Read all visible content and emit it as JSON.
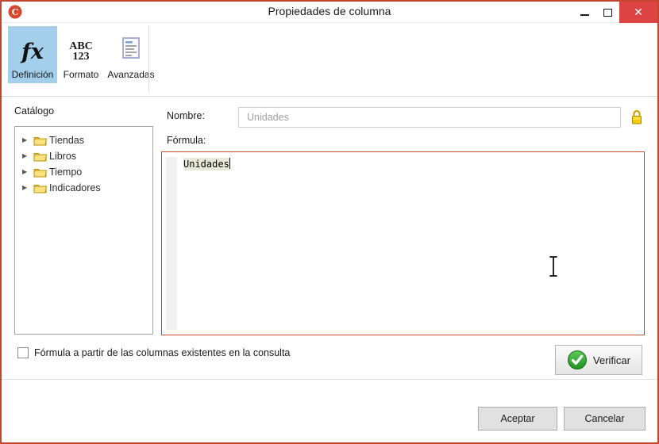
{
  "window": {
    "title": "Propiedades de columna"
  },
  "icons": {
    "app_logo_glyph": "C",
    "close_glyph": "✕",
    "tree_collapsed_glyph": "▶",
    "fx_glyph": "fx",
    "abc_line1": "ABC",
    "abc_line2": "123"
  },
  "toolbar": {
    "tabs": [
      {
        "label": "Definición",
        "icon": "fx-icon",
        "selected": true
      },
      {
        "label": "Formato",
        "icon": "abc-123-icon",
        "selected": false
      },
      {
        "label": "Avanzadas",
        "icon": "list-form-icon",
        "selected": false
      }
    ]
  },
  "catalog": {
    "label": "Catálogo",
    "items": [
      {
        "label": "Tiendas",
        "icon": "folder-icon",
        "expanded": false
      },
      {
        "label": "Libros",
        "icon": "folder-icon",
        "expanded": false
      },
      {
        "label": "Tiempo",
        "icon": "folder-icon",
        "expanded": false
      },
      {
        "label": "Indicadores",
        "icon": "folder-icon",
        "expanded": false
      }
    ]
  },
  "fields": {
    "name": {
      "label": "Nombre:",
      "value": "Unidades",
      "locked": true
    },
    "formula": {
      "label": "Fórmula:",
      "value": "Unidades"
    }
  },
  "options": {
    "from_existing_columns": {
      "label": "Fórmula a partir de las columnas existentes en la consulta",
      "checked": false
    }
  },
  "buttons": {
    "verify": "Verificar",
    "accept": "Aceptar",
    "cancel": "Cancelar"
  },
  "colors": {
    "window_border": "#c0462e",
    "close_button": "#dd4343",
    "selected_tab": "#a3cfeb",
    "formula_border": "#cb4a2d",
    "formula_highlight": "#e9e9da",
    "folder": "#f7dc6f",
    "lock": "#f3c800",
    "verify_green": "#2fa52f"
  }
}
